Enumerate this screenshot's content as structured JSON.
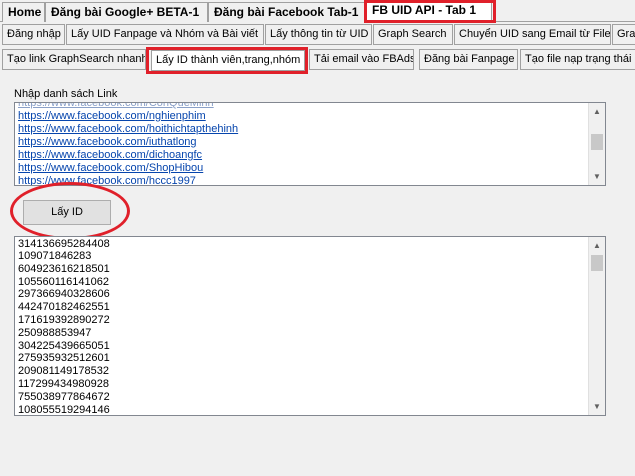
{
  "top_tabs": [
    {
      "label": "Home"
    },
    {
      "label": "Đăng bài Google+ BETA-1"
    },
    {
      "label": "Đăng bài Facebook Tab-1"
    },
    {
      "label": "FB UID API - Tab 1"
    }
  ],
  "row1_tabs": [
    {
      "label": "Đăng nhập"
    },
    {
      "label": "Lấy UID Fanpage và Nhóm và Bài viết"
    },
    {
      "label": "Lấy thông tin từ UID"
    },
    {
      "label": "Graph Search"
    },
    {
      "label": "Chuyển UID sang Email từ File"
    },
    {
      "label": "Gra"
    }
  ],
  "row2_tabs": [
    {
      "label": "Tạo link GraphSearch nhanh"
    },
    {
      "label": "Lấy ID thành viên,trang,nhóm"
    },
    {
      "label": "Tải email vào FBAds"
    },
    {
      "label": "Đăng bài Fanpage"
    },
    {
      "label": "Tạo file nạp trạng thái n"
    }
  ],
  "input_label": "Nhập danh sách Link",
  "links": [
    "https://www.facebook.com/nghienphim",
    "https://www.facebook.com/hoithichtapthehinh",
    "https://www.facebook.com/iuthatlong",
    "https://www.facebook.com/dichoangfc",
    "https://www.facebook.com/ShopHibou",
    "https://www.facebook.com/hccc1997"
  ],
  "get_id_button": "Lấy ID",
  "ids": [
    "314136695284408",
    "109071846283",
    "604923616218501",
    "105560116141062",
    "297366940328606",
    "442470182462551",
    "171619392890272",
    "250988853947",
    "304225439665051",
    "275935932512601",
    "209081149178532",
    "117299434980928",
    "755038977864672",
    "108055519294146"
  ],
  "colors": {
    "highlight": "#e0202a",
    "link": "#0645ad"
  }
}
